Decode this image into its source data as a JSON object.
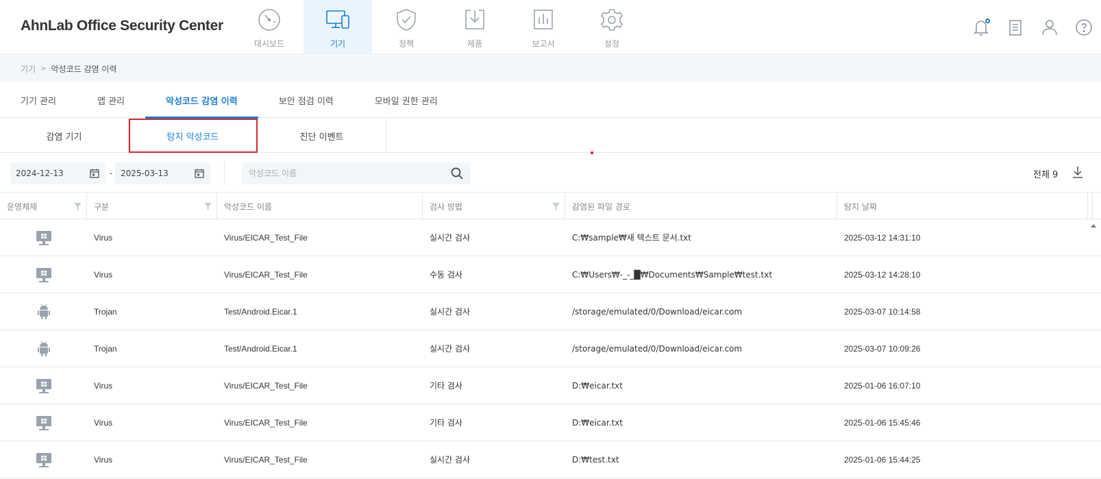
{
  "app": {
    "title": "AhnLab Office Security Center"
  },
  "topnav": [
    {
      "label": "대시보드",
      "icon": "dashboard-gauge-icon",
      "active": false
    },
    {
      "label": "기기",
      "icon": "devices-icon",
      "active": true
    },
    {
      "label": "정책",
      "icon": "shield-check-icon",
      "active": false
    },
    {
      "label": "제품",
      "icon": "download-box-icon",
      "active": false
    },
    {
      "label": "보고서",
      "icon": "report-chart-icon",
      "active": false
    },
    {
      "label": "설정",
      "icon": "gear-icon",
      "active": false
    }
  ],
  "header_icons": [
    "bell-icon",
    "clipboard-icon",
    "user-icon",
    "help-icon"
  ],
  "breadcrumb": {
    "parent": "기기",
    "separator": ">",
    "current": "악성코드 감염 이력"
  },
  "tabs": [
    {
      "label": "기기 관리",
      "active": false
    },
    {
      "label": "앱 관리",
      "active": false
    },
    {
      "label": "악성코드 감염 이력",
      "active": true
    },
    {
      "label": "보안 점검 이력",
      "active": false
    },
    {
      "label": "모바일 권한 관리",
      "active": false
    }
  ],
  "subtabs": [
    {
      "label": "감염 기기",
      "active": false
    },
    {
      "label": "탐지 악성코드",
      "active": true
    },
    {
      "label": "진단 이벤트",
      "active": false
    }
  ],
  "filters": {
    "start_date": "2024-12-13",
    "date_separator": "-",
    "end_date": "2025-03-13",
    "search_placeholder": "악성코드 이름",
    "total_label": "전체 9"
  },
  "table": {
    "columns": [
      "운영체제",
      "구분",
      "악성코드 이름",
      "검사 방법",
      "감염된 파일 경로",
      "탐지 날짜"
    ],
    "rows": [
      {
        "os": "windows",
        "category": "Virus",
        "name": "Virus/EICAR_Test_File",
        "method": "실시간 검사",
        "path": "C:₩sample₩새 텍스트 문서.txt",
        "date": "2025-03-12 14:31:10"
      },
      {
        "os": "windows",
        "category": "Virus",
        "name": "Virus/EICAR_Test_File",
        "method": "수동 검사",
        "path": "C:₩Users₩-_-_█₩Documents₩Sample₩test.txt",
        "date": "2025-03-12 14:28:10"
      },
      {
        "os": "android",
        "category": "Trojan",
        "name": "Test/Android.Eicar.1",
        "method": "실시간 검사",
        "path": "/storage/emulated/0/Download/eicar.com",
        "date": "2025-03-07 10:14:58"
      },
      {
        "os": "android",
        "category": "Trojan",
        "name": "Test/Android.Eicar.1",
        "method": "실시간 검사",
        "path": "/storage/emulated/0/Download/eicar.com",
        "date": "2025-03-07 10:09:26"
      },
      {
        "os": "windows",
        "category": "Virus",
        "name": "Virus/EICAR_Test_File",
        "method": "기타 검사",
        "path": "D:₩eicar.txt",
        "date": "2025-01-06 16:07:10"
      },
      {
        "os": "windows",
        "category": "Virus",
        "name": "Virus/EICAR_Test_File",
        "method": "기타 검사",
        "path": "D:₩eicar.txt",
        "date": "2025-01-06 15:45:46"
      },
      {
        "os": "windows",
        "category": "Virus",
        "name": "Virus/EICAR_Test_File",
        "method": "실시간 검사",
        "path": "D:₩test.txt",
        "date": "2025-01-06 15:44:25"
      }
    ]
  },
  "colors": {
    "accent": "#1a7fd4",
    "active_bg": "#eaf4fd",
    "highlight_box": "#d9252b",
    "border": "#e3e7ea",
    "breadcrumb_bg": "#f3f6f8",
    "icon_gray": "#9aa3ad"
  }
}
